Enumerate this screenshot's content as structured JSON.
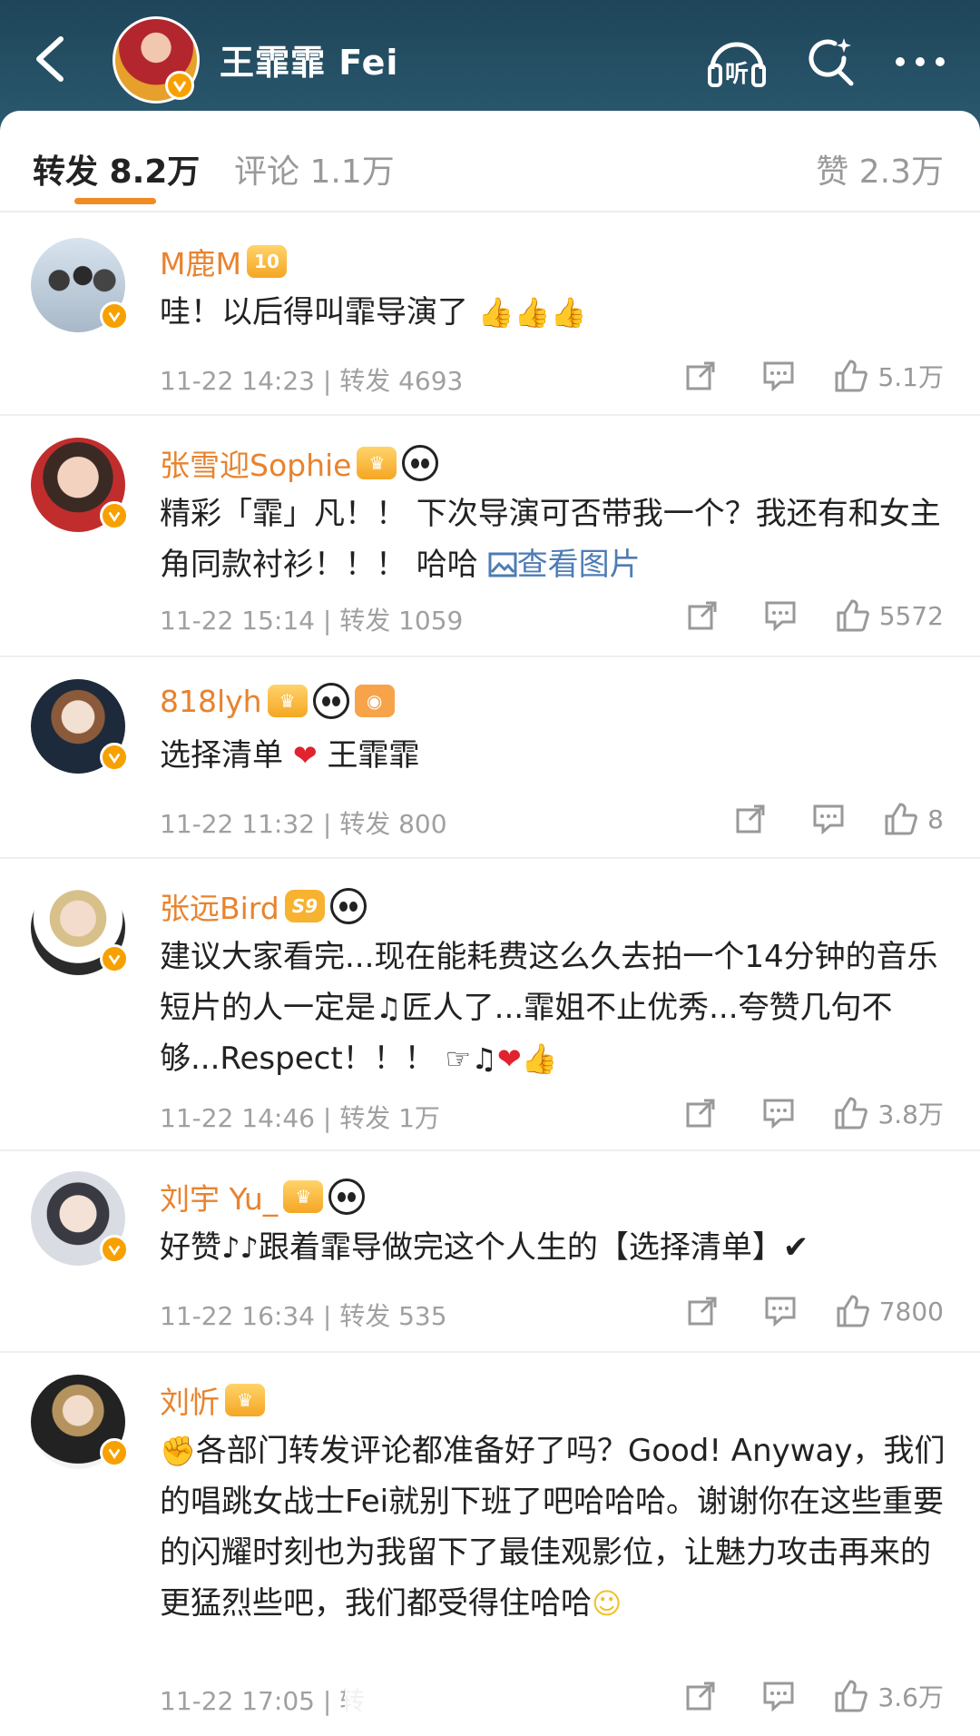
{
  "header": {
    "profile_name": "王霏霏 Fei",
    "icons": [
      "back-icon",
      "listen-icon",
      "search-icon",
      "more-icon"
    ],
    "listen_label": "听",
    "bg_color": "#24506a"
  },
  "tabs": [
    {
      "label": "转发 8.2万",
      "active": true
    },
    {
      "label": "评论 1.1万",
      "active": false
    },
    {
      "label": "赞 2.3万",
      "active": false
    }
  ],
  "accent_color": "#f08a22",
  "name_color": "#e8832e",
  "comments": [
    {
      "user": "M鹿M",
      "vip_level": "10",
      "text": "哇！以后得叫霏导演了",
      "emojis": [
        "👍",
        "👍",
        "👍"
      ],
      "time": "11-22 14:23",
      "repost": "转发 4693",
      "likes": "5.1万"
    },
    {
      "user": "张雪迎Sophie",
      "text": "精彩「霏」凡！！ 下次导演可否带我一个？我还有和女主角同款衬衫！！！ 哈哈",
      "link": "查看图片",
      "time": "11-22 15:14",
      "repost": "转发 1059",
      "likes": "5572"
    },
    {
      "user": "818lyh",
      "text_before": "选择清单",
      "text_after": "王霏霏",
      "time": "11-22 11:32",
      "repost": "转发 800",
      "likes": "8"
    },
    {
      "user": "张远Bird",
      "badge": "S9",
      "text": "建议大家看完...现在能耗费这么久去拍一个14分钟的音乐短片的人一定是",
      "text2": "匠人了...霏姐不止优秀...夸赞几句不够...Respect！！！",
      "time": "11-22 14:46",
      "repost": "转发 1万",
      "likes": "3.8万"
    },
    {
      "user": "刘宇 Yu_",
      "text_before": "好赞",
      "text_after": "跟着霏导做完这个人生的【选择清单】✔",
      "time": "11-22 16:34",
      "repost": "转发 535",
      "likes": "7800"
    },
    {
      "user": "刘忻",
      "text": "各部门转发评论都准备好了吗？Good! Anyway，我们的唱跳女战士Fei就别下班了吧哈哈哈。谢谢你在这些重要的闪耀时刻也为我留下了最佳观影位，让魅力攻击再来的更猛烈些吧，我们都受得住哈哈",
      "time": "11-22 17:05",
      "repost": "转",
      "likes": "3.6万"
    }
  ]
}
